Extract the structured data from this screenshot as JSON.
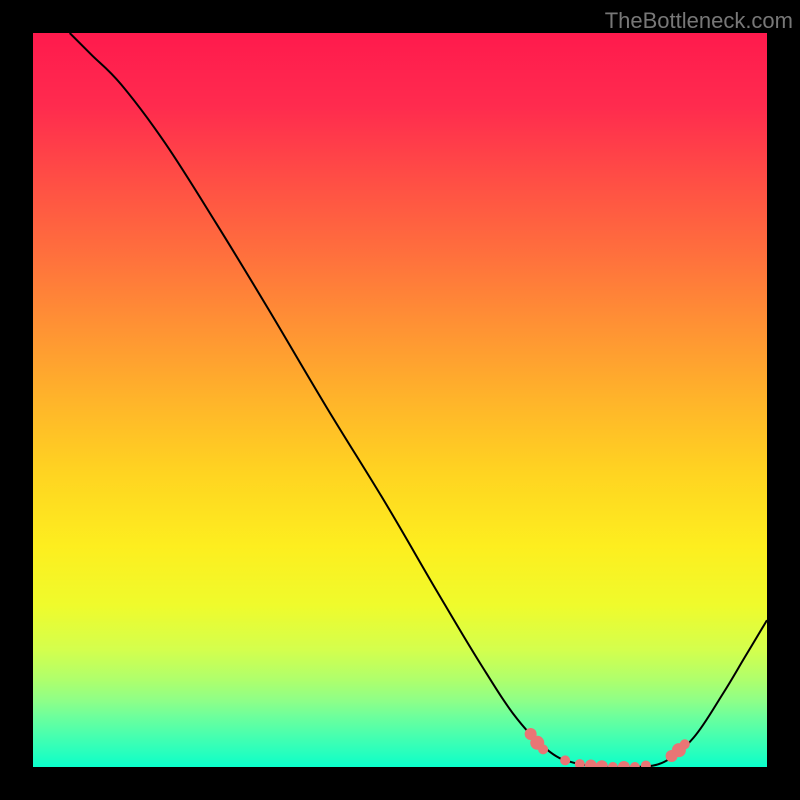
{
  "watermark": "TheBottleneck.com",
  "colors": {
    "curve": "#000000",
    "dot": "#e97575"
  },
  "chart_data": {
    "type": "line",
    "title": "",
    "xlabel": "",
    "ylabel": "",
    "xlim": [
      0,
      100
    ],
    "ylim": [
      0,
      100
    ],
    "curve": [
      {
        "x": 5,
        "y": 100
      },
      {
        "x": 8,
        "y": 97
      },
      {
        "x": 12,
        "y": 93
      },
      {
        "x": 18,
        "y": 85
      },
      {
        "x": 25,
        "y": 74
      },
      {
        "x": 32,
        "y": 62.5
      },
      {
        "x": 40,
        "y": 49
      },
      {
        "x": 48,
        "y": 36
      },
      {
        "x": 55,
        "y": 24
      },
      {
        "x": 61,
        "y": 14
      },
      {
        "x": 66,
        "y": 6.5
      },
      {
        "x": 70.5,
        "y": 2
      },
      {
        "x": 74,
        "y": 0.5
      },
      {
        "x": 78,
        "y": 0
      },
      {
        "x": 82,
        "y": 0
      },
      {
        "x": 86,
        "y": 0.7
      },
      {
        "x": 90,
        "y": 4
      },
      {
        "x": 94,
        "y": 10
      },
      {
        "x": 97,
        "y": 15
      },
      {
        "x": 100,
        "y": 20
      }
    ],
    "dots": [
      {
        "x": 67.8,
        "y": 4.5,
        "r": 6
      },
      {
        "x": 68.7,
        "y": 3.3,
        "r": 7
      },
      {
        "x": 69.5,
        "y": 2.4,
        "r": 5
      },
      {
        "x": 72.5,
        "y": 0.9,
        "r": 5
      },
      {
        "x": 74.5,
        "y": 0.4,
        "r": 5
      },
      {
        "x": 76.0,
        "y": 0.2,
        "r": 6
      },
      {
        "x": 77.5,
        "y": 0.1,
        "r": 6
      },
      {
        "x": 79.0,
        "y": 0.0,
        "r": 5
      },
      {
        "x": 80.5,
        "y": 0.0,
        "r": 6
      },
      {
        "x": 82.0,
        "y": 0.0,
        "r": 5
      },
      {
        "x": 83.5,
        "y": 0.2,
        "r": 5
      },
      {
        "x": 87.0,
        "y": 1.5,
        "r": 6
      },
      {
        "x": 88.0,
        "y": 2.3,
        "r": 7
      },
      {
        "x": 88.8,
        "y": 3.1,
        "r": 5
      }
    ]
  }
}
